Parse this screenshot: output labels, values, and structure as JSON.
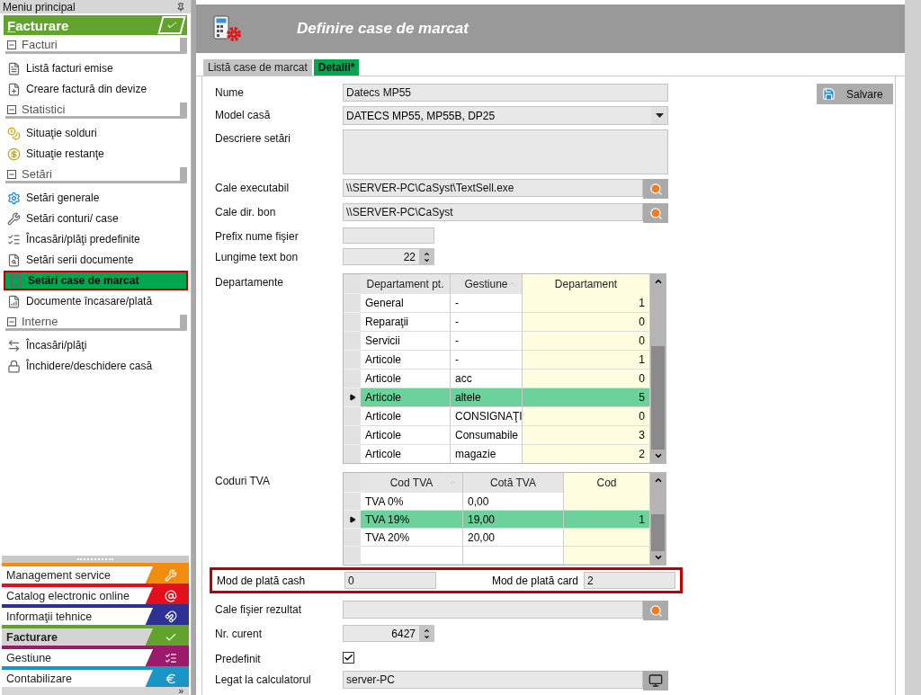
{
  "sidebar": {
    "title": "Meniu principal",
    "module_title": "Facturare",
    "sections": [
      {
        "label": "Facturi",
        "expanded": true,
        "items": [
          {
            "label": "Listă facturi emise",
            "selected": false
          },
          {
            "label": "Creare factură din devize",
            "selected": false
          }
        ]
      },
      {
        "label": "Statistici",
        "expanded": true,
        "items": [
          {
            "label": "Situaţie solduri",
            "selected": false
          },
          {
            "label": "Situaţie restanţe",
            "selected": false
          }
        ]
      },
      {
        "label": "Setări",
        "expanded": true,
        "items": [
          {
            "label": "Setări generale",
            "selected": false
          },
          {
            "label": "Setări conturi/ case",
            "selected": false
          },
          {
            "label": "Încasări/plăţi predefinite",
            "selected": false
          },
          {
            "label": "Setări serii documente",
            "selected": false
          },
          {
            "label": "Setări case de marcat",
            "selected": true
          },
          {
            "label": "Documente încasare/plată",
            "selected": false
          }
        ]
      },
      {
        "label": "Interne",
        "expanded": true,
        "items": [
          {
            "label": "Încasări/plăţi",
            "selected": false
          },
          {
            "label": "Închidere/deschidere casă",
            "selected": false
          }
        ]
      }
    ],
    "modules": [
      {
        "label": "Management service",
        "color": "#f08c10",
        "selected": false
      },
      {
        "label": "Catalog electronic online",
        "color": "#e2101c",
        "selected": false
      },
      {
        "label": "Informaţii tehnice",
        "color": "#2e3192",
        "selected": false
      },
      {
        "label": "Facturare",
        "color": "#62a32e",
        "selected": true
      },
      {
        "label": "Gestiune",
        "color": "#9b1b6a",
        "selected": false
      },
      {
        "label": "Contabilizare",
        "color": "#1a95c4",
        "selected": false
      }
    ],
    "overflow_button": "»"
  },
  "main": {
    "title": "Definire case de marcat",
    "tabs": [
      {
        "label": "Listă case de marcat",
        "selected": false
      },
      {
        "label": "Detalii*",
        "selected": true
      }
    ],
    "save_button": "Salvare",
    "fields": [
      {
        "kind": "text",
        "label": "Nume",
        "value": "Datecs MP55"
      },
      {
        "kind": "select",
        "label": "Model casă",
        "value": "DATECS MP55, MP55B, DP25"
      },
      {
        "kind": "textarea",
        "label": "Descriere setări"
      },
      {
        "kind": "browse",
        "label": "Cale executabil",
        "value": "\\\\SERVER-PC\\CaSyst\\TextSell.exe"
      },
      {
        "kind": "browse",
        "label": "Cale dir. bon",
        "value": "\\\\SERVER-PC\\CaSyst"
      },
      {
        "kind": "short",
        "label": "Prefix nume fişier"
      },
      {
        "kind": "spin",
        "label": "Lungime text bon",
        "value": "22"
      },
      {
        "kind": "grid",
        "label": "Departamente",
        "columns": [
          {
            "label": "Departament pt.",
            "sortable": true
          },
          {
            "label": "Gestiune",
            "sortable": true
          },
          {
            "label": "Departament",
            "sortable": false
          }
        ],
        "rows": [
          {
            "cells": [
              "General",
              "-",
              "1"
            ],
            "selected": false
          },
          {
            "cells": [
              "Reparaţii",
              "-",
              "0"
            ],
            "selected": false
          },
          {
            "cells": [
              "Servicii",
              "-",
              "0"
            ],
            "selected": false
          },
          {
            "cells": [
              "Articole",
              "-",
              "1"
            ],
            "selected": false
          },
          {
            "cells": [
              "Articole",
              "acc",
              "0"
            ],
            "selected": false
          },
          {
            "cells": [
              "Articole",
              "altele",
              "5"
            ],
            "selected": true
          },
          {
            "cells": [
              "Articole",
              "CONSIGNAŢI",
              "0"
            ],
            "selected": false
          },
          {
            "cells": [
              "Articole",
              "Consumabile",
              "3"
            ],
            "selected": false
          },
          {
            "cells": [
              "Articole",
              "magazie",
              "2"
            ],
            "selected": false
          }
        ]
      },
      {
        "kind": "grid",
        "label": "Coduri TVA",
        "columns": [
          {
            "label": "Cod TVA",
            "sortable": true
          },
          {
            "label": "Cotă TVA",
            "sortable": false
          },
          {
            "label": "Cod",
            "sortable": false
          }
        ],
        "rows": [
          {
            "cells": [
              "TVA 0%",
              "0,00",
              ""
            ],
            "selected": false
          },
          {
            "cells": [
              "TVA 19%",
              "19,00",
              "1"
            ],
            "selected": true
          },
          {
            "cells": [
              "TVA 20%",
              "20,00",
              ""
            ],
            "selected": false
          }
        ]
      },
      {
        "kind": "pair",
        "label": "Mod de plată cash",
        "value": "0",
        "label2": "Mod de plată card",
        "value2": "2",
        "highlighted": true
      },
      {
        "kind": "browse",
        "label": "Cale fişier rezultat"
      },
      {
        "kind": "spin",
        "label": "Nr. curent",
        "value": "6427"
      },
      {
        "kind": "checkbox",
        "label": "Predefinit",
        "checked": true
      },
      {
        "kind": "computer",
        "label": "Legat la calculatorul",
        "value": "server-PC"
      }
    ]
  }
}
